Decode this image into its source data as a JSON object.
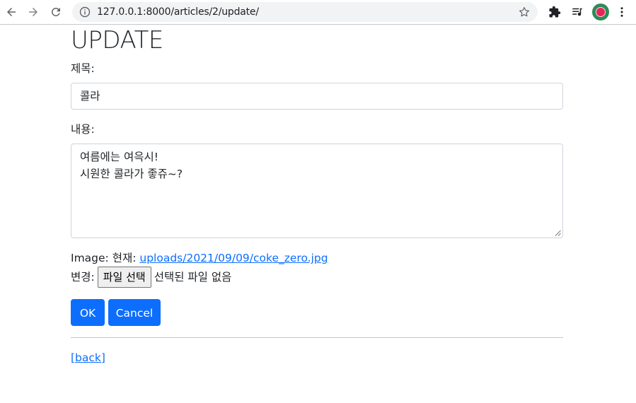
{
  "browser": {
    "url": "127.0.0.1:8000/articles/2/update/"
  },
  "page": {
    "title": "UPDATE",
    "form": {
      "title_label": "제목:",
      "title_value": "콜라",
      "content_label": "내용:",
      "content_lines": [
        "여름에는 여윽시!",
        "시원한 콜라가 좋쥬~?"
      ],
      "image_label": "Image: 현재: ",
      "image_link": "uploads/2021/09/09/coke_zero.jpg",
      "change_label": "변경:",
      "file_button": "파일 선택",
      "file_status": "선택된 파일 없음",
      "ok_button": "OK",
      "cancel_button": "Cancel"
    },
    "back_link": "[back]"
  },
  "colors": {
    "primary": "#0d6efd",
    "text": "#212529",
    "border": "#ced4da"
  }
}
